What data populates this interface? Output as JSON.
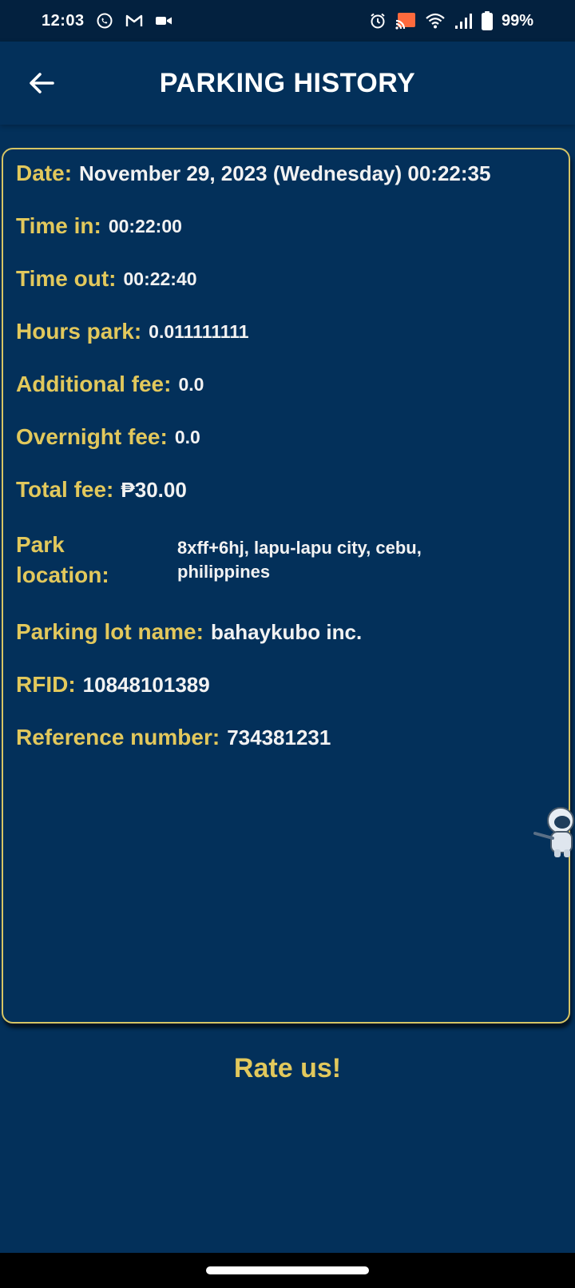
{
  "status_bar": {
    "time": "12:03",
    "battery_percent": "99%",
    "left_icons": [
      "viber-icon",
      "gmail-icon",
      "video-camera-icon"
    ],
    "right_icons": [
      "alarm-icon",
      "cast-icon",
      "wifi-icon",
      "signal-icon",
      "battery-icon"
    ]
  },
  "app_bar": {
    "title": "PARKING HISTORY",
    "back_icon": "arrow-left-icon"
  },
  "record": {
    "date_label": "Date:",
    "date_value": "November 29, 2023 (Wednesday) 00:22:35",
    "time_in_label": "Time in:",
    "time_in_value": "00:22:00",
    "time_out_label": "Time out:",
    "time_out_value": "00:22:40",
    "hours_park_label": "Hours park:",
    "hours_park_value": "0.011111111",
    "additional_fee_label": "Additional fee:",
    "additional_fee_value": "0.0",
    "overnight_fee_label": "Overnight fee:",
    "overnight_fee_value": "0.0",
    "total_fee_label": "Total fee:",
    "total_fee_value": "₱30.00",
    "park_location_label": "Park location:",
    "park_location_value": "8xff+6hj, lapu-lapu city, cebu, philippines",
    "lot_name_label": "Parking lot name:",
    "lot_name_value": "bahaykubo inc.",
    "rfid_label": "RFID:",
    "rfid_value": "10848101389",
    "reference_label": "Reference number:",
    "reference_value": "734381231"
  },
  "rate_button_label": "Rate us!",
  "colors": {
    "background": "#03305a",
    "status_bar": "#03213f",
    "accent_gold": "#e2c85c",
    "card_border": "#d6c465",
    "value_text": "#f2f2f2"
  }
}
